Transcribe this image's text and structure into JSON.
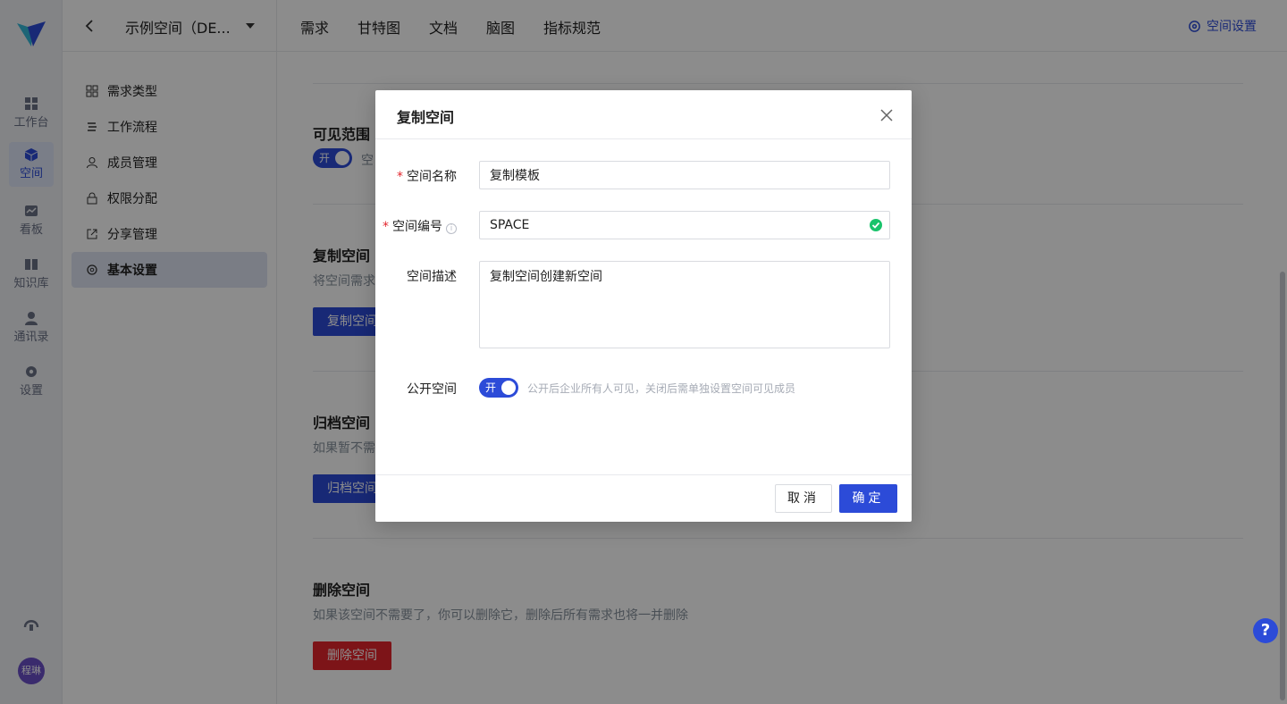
{
  "topbar": {
    "space_name": "示例空间（DE...",
    "tabs": [
      "需求",
      "甘特图",
      "文档",
      "脑图",
      "指标规范"
    ],
    "settings_link": "空间设置"
  },
  "rail": {
    "items": [
      "工作台",
      "空间",
      "看板",
      "知识库",
      "通讯录",
      "设置"
    ],
    "active": "空间",
    "avatar_text": "程琳"
  },
  "settings_menu": {
    "items": [
      "需求类型",
      "工作流程",
      "成员管理",
      "权限分配",
      "分享管理",
      "基本设置"
    ],
    "active": "基本设置"
  },
  "main": {
    "visibility": {
      "title": "可见范围",
      "toggle_label": "开",
      "side_text": "空"
    },
    "copy": {
      "title": "复制空间",
      "desc": "将空间需求",
      "button": "复制空间"
    },
    "archive": {
      "title": "归档空间",
      "desc": "如果暂不需",
      "button": "归档空间"
    },
    "delete": {
      "title": "删除空间",
      "desc": "如果该空间不需要了，你可以删除它，删除后所有需求也将一并删除",
      "button": "删除空间"
    }
  },
  "modal": {
    "title": "复制空间",
    "fields": {
      "name": {
        "label": "空间名称",
        "value": "复制模板",
        "required": true
      },
      "code": {
        "label": "空间编号",
        "value": "SPACE",
        "required": true,
        "info_icon": "i"
      },
      "desc": {
        "label": "空间描述",
        "value": "复制空间创建新空间"
      },
      "public": {
        "label": "公开空间",
        "toggle_label": "开",
        "hint": "公开后企业所有人可见，关闭后需单独设置空间可见成员"
      }
    },
    "cancel_label": "取消",
    "ok_label": "确定"
  },
  "help": "?",
  "colors": {
    "primary": "#2c4bd8",
    "danger": "#e3262d",
    "success": "#19c36b"
  }
}
